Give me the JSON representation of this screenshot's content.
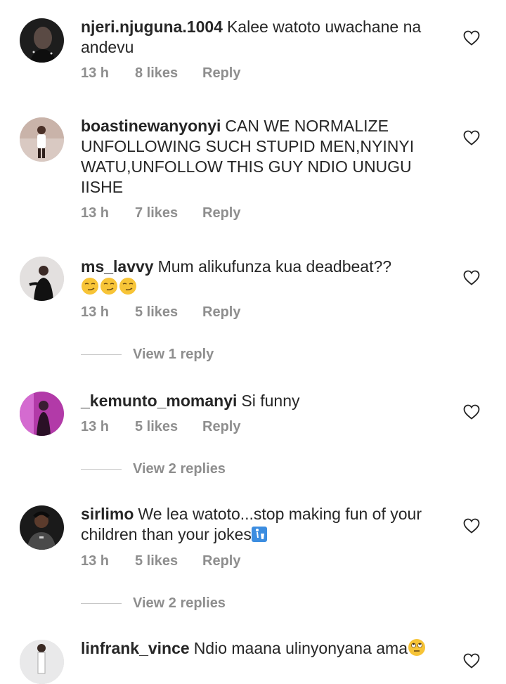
{
  "comments": [
    {
      "username": "njeri.njuguna.1004",
      "text": "Kalee watoto uwachane na andevu",
      "time": "13 h",
      "likes": "8 likes",
      "reply": "Reply",
      "avatar_color": "#2b2b2b"
    },
    {
      "username": "boastinewanyonyi",
      "text": "CAN WE NORMALIZE UNFOLLOWING SUCH STUPID MEN,NYINYI WATU,UNFOLLOW THIS GUY NDIO UNUGU IISHE",
      "time": "13 h",
      "likes": "7 likes",
      "reply": "Reply",
      "avatar_color": "#d9c9c2"
    },
    {
      "username": "ms_lavvy",
      "text": "Mum alikufunza kua deadbeat??",
      "emoji_line": "smirking-face x3",
      "time": "13 h",
      "likes": "5 likes",
      "reply": "Reply",
      "view_replies": "View 1 reply",
      "avatar_color": "#e3e0df"
    },
    {
      "username": "_kemunto_momanyi",
      "text": "Si funny",
      "time": "13 h",
      "likes": "5 likes",
      "reply": "Reply",
      "view_replies": "View 2 replies",
      "avatar_color": "#b23aa8"
    },
    {
      "username": "sirlimo",
      "text": "We lea watoto...stop making fun of your children than your jokes",
      "trailing_icon": "put-litter-icon",
      "time": "13 h",
      "likes": "5 likes",
      "reply": "Reply",
      "view_replies": "View 2 replies",
      "avatar_color": "#3a3a3a"
    },
    {
      "username": "linfrank_vince",
      "text": "Ndio maana ulinyonyana ama",
      "trailing_icon": "eye-roll-emoji",
      "avatar_color": "#e9e9ea"
    }
  ],
  "colors": {
    "text": "#262626",
    "meta": "#8e8e8e",
    "divider": "#c7c7c7",
    "emoji_yellow": "#f7c437"
  }
}
